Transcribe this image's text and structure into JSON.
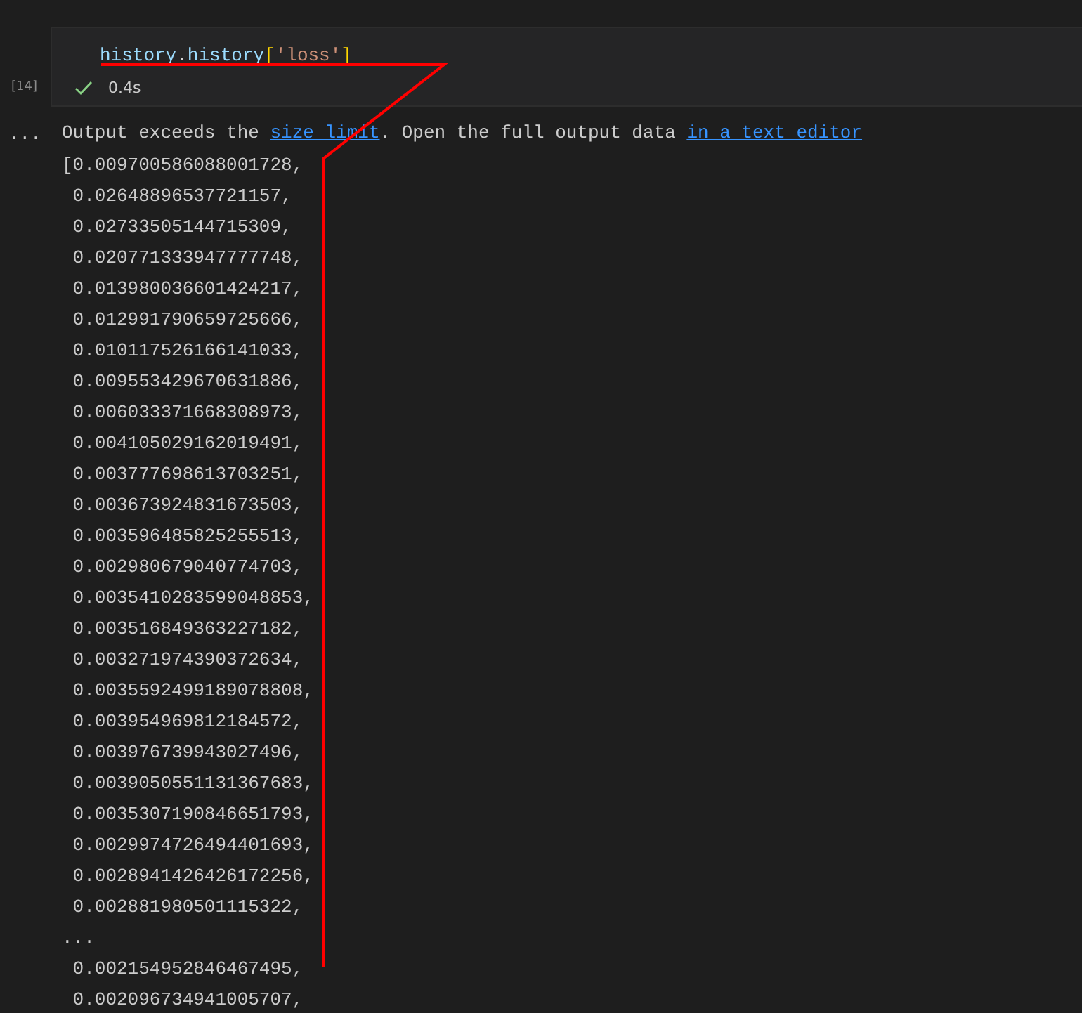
{
  "cell": {
    "execution_count": "[14]",
    "code": [
      {
        "text": "history",
        "kind": "variable"
      },
      {
        "text": ".",
        "kind": "punct"
      },
      {
        "text": "history",
        "kind": "variable"
      },
      {
        "text": "[",
        "kind": "bracket"
      },
      {
        "text": "'loss'",
        "kind": "string"
      },
      {
        "text": "]",
        "kind": "bracket"
      }
    ],
    "status": {
      "succeeded": true,
      "duration": "0.4s"
    }
  },
  "output": {
    "menu": "...",
    "message": [
      {
        "text": "Output exceeds the ",
        "kind": "text"
      },
      {
        "text": "size limit",
        "kind": "link"
      },
      {
        "text": ". Open the full output data ",
        "kind": "text"
      },
      {
        "text": "in a text editor",
        "kind": "link"
      }
    ],
    "lines": [
      "[0.009700586088001728,",
      " 0.02648896537721157,",
      " 0.02733505144715309,",
      " 0.020771333947777748,",
      " 0.013980036601424217,",
      " 0.012991790659725666,",
      " 0.010117526166141033,",
      " 0.009553429670631886,",
      " 0.006033371668308973,",
      " 0.004105029162019491,",
      " 0.003777698613703251,",
      " 0.003673924831673503,",
      " 0.003596485825255513,",
      " 0.002980679040774703,",
      " 0.0035410283599048853,",
      " 0.003516849363227182,",
      " 0.003271974390372634,",
      " 0.0035592499189078808,",
      " 0.003954969812184572,",
      " 0.003976739943027496,",
      " 0.0039050551131367683,",
      " 0.0035307190846651793,",
      " 0.0029974726494401693,",
      " 0.0028941426426172256,",
      " 0.002881980501115322,",
      "...",
      " 0.002154952846467495,",
      " 0.002096734941005707,"
    ]
  }
}
